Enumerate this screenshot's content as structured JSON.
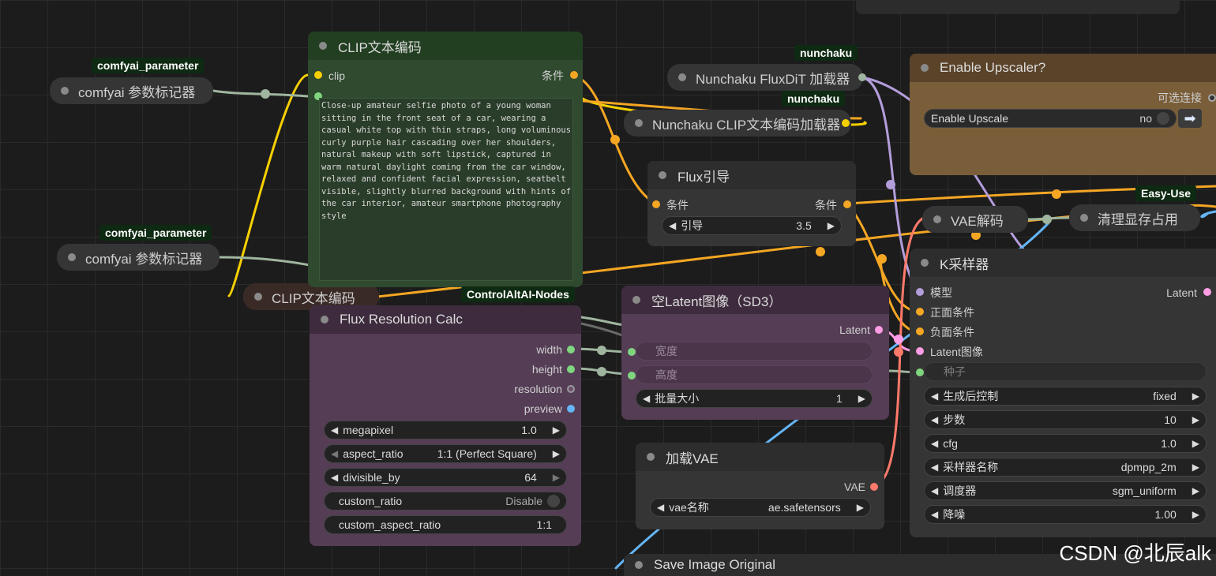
{
  "nodes": {
    "clip_text_node": {
      "title": "CLIP文本编码",
      "input_clip": "clip",
      "output_condition": "条件",
      "prompt": "Close-up amateur selfie photo of a young woman sitting in the front seat of a car, wearing a casual white top with thin straps, long voluminous curly purple hair cascading over her shoulders, natural makeup with soft lipstick, captured in warm natural daylight coming from the car window, relaxed and confident facial expression, seatbelt visible, slightly blurred background with hints of the car interior, amateur smartphone photography style"
    },
    "param_marker_1": {
      "tag": "comfyai_parameter",
      "title": "comfyai 参数标记器"
    },
    "param_marker_2": {
      "tag": "comfyai_parameter",
      "title": "comfyai 参数标记器"
    },
    "clip_text_collapsed": {
      "title": "CLIP文本编码"
    },
    "nunchaku_dit": {
      "tag": "nunchaku",
      "title": "Nunchaku FluxDiT 加载器"
    },
    "nunchaku_clip": {
      "tag": "nunchaku",
      "title": "Nunchaku CLIP文本编码加载器"
    },
    "enable_upscaler": {
      "title": "Enable Upscaler?",
      "output": "可选连接",
      "toggle_label": "Enable Upscale",
      "toggle_value": "no"
    },
    "flux_guidance": {
      "title": "Flux引导",
      "input": "条件",
      "output": "条件",
      "widget_label": "引导",
      "widget_value": "3.5"
    },
    "vae_decode": {
      "title": "VAE解码"
    },
    "clear_vram": {
      "tag": "Easy-Use",
      "title": "清理显存占用"
    },
    "ksampler": {
      "title": "K采样器",
      "inputs": [
        "模型",
        "正面条件",
        "负面条件",
        "Latent图像"
      ],
      "output": "Latent",
      "seed_placeholder": "种子",
      "widgets": [
        {
          "label": "生成后控制",
          "value": "fixed"
        },
        {
          "label": "步数",
          "value": "10"
        },
        {
          "label": "cfg",
          "value": "1.0"
        },
        {
          "label": "采样器名称",
          "value": "dpmpp_2m"
        },
        {
          "label": "调度器",
          "value": "sgm_uniform"
        },
        {
          "label": "降噪",
          "value": "1.00"
        }
      ]
    },
    "flux_resolution": {
      "tag": "ControlAltAI-Nodes",
      "title": "Flux Resolution Calc",
      "outputs": [
        "width",
        "height",
        "resolution",
        "preview"
      ],
      "widgets": [
        {
          "label": "megapixel",
          "value": "1.0"
        },
        {
          "label": "aspect_ratio",
          "value": "1:1 (Perfect Square)"
        },
        {
          "label": "divisible_by",
          "value": "64"
        },
        {
          "label": "custom_ratio",
          "value": "Disable"
        },
        {
          "label": "custom_aspect_ratio",
          "value": "1:1"
        }
      ]
    },
    "empty_latent": {
      "title": "空Latent图像（SD3）",
      "output": "Latent",
      "width_placeholder": "宽度",
      "height_placeholder": "高度",
      "batch_label": "批量大小",
      "batch_value": "1"
    },
    "load_vae": {
      "title": "加载VAE",
      "output": "VAE",
      "widget_label": "vae名称",
      "widget_value": "ae.safetensors"
    },
    "save_image": {
      "title": "Save Image Original"
    }
  },
  "watermark": "CSDN @北辰alk",
  "colors": {
    "wire_condition": "#f5a623",
    "wire_clip": "#f7d000",
    "wire_latent": "#ff9ce6",
    "wire_vae": "#ff7a6a",
    "wire_model": "#b39ddb",
    "wire_int": "#9fb59f",
    "wire_image": "#64b5f6"
  }
}
